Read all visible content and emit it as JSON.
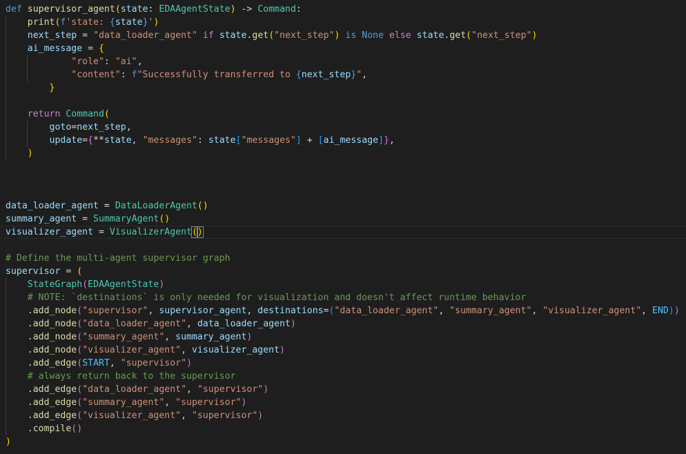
{
  "editor": {
    "lines": [
      [
        [
          "def",
          "kw"
        ],
        [
          " ",
          ""
        ],
        [
          "supervisor_agent",
          "fn"
        ],
        [
          "(",
          "b1"
        ],
        [
          "state",
          "var"
        ],
        [
          ": ",
          ""
        ],
        [
          "EDAAgentState",
          "cls"
        ],
        [
          ")",
          "b1"
        ],
        [
          " -> ",
          ""
        ],
        [
          "Command",
          "cls"
        ],
        [
          ":",
          ""
        ]
      ],
      [
        [
          "    ",
          ""
        ],
        [
          "print",
          "fn"
        ],
        [
          "(",
          "b1"
        ],
        [
          "f",
          "kw"
        ],
        [
          "'state: ",
          "str"
        ],
        [
          "{",
          "kw"
        ],
        [
          "state",
          "var"
        ],
        [
          "}",
          "kw"
        ],
        [
          "'",
          "str"
        ],
        [
          ")",
          "b1"
        ]
      ],
      [
        [
          "    ",
          ""
        ],
        [
          "next_step",
          "var"
        ],
        [
          " = ",
          ""
        ],
        [
          "\"data_loader_agent\"",
          "str"
        ],
        [
          " ",
          ""
        ],
        [
          "if",
          "ctl"
        ],
        [
          " ",
          ""
        ],
        [
          "state",
          "var"
        ],
        [
          ".",
          ""
        ],
        [
          "get",
          "fn"
        ],
        [
          "(",
          "b1"
        ],
        [
          "\"next_step\"",
          "str"
        ],
        [
          ")",
          "b1"
        ],
        [
          " ",
          ""
        ],
        [
          "is",
          "kw"
        ],
        [
          " ",
          ""
        ],
        [
          "None",
          "kw"
        ],
        [
          " ",
          ""
        ],
        [
          "else",
          "ctl"
        ],
        [
          " ",
          ""
        ],
        [
          "state",
          "var"
        ],
        [
          ".",
          ""
        ],
        [
          "get",
          "fn"
        ],
        [
          "(",
          "b1"
        ],
        [
          "\"next_step\"",
          "str"
        ],
        [
          ")",
          "b1"
        ]
      ],
      [
        [
          "    ",
          ""
        ],
        [
          "ai_message",
          "var"
        ],
        [
          " = ",
          ""
        ],
        [
          "{",
          "b1"
        ]
      ],
      [
        [
          "            ",
          ""
        ],
        [
          "\"role\"",
          "str"
        ],
        [
          ": ",
          ""
        ],
        [
          "\"ai\"",
          "str"
        ],
        [
          ",",
          ""
        ]
      ],
      [
        [
          "            ",
          ""
        ],
        [
          "\"content\"",
          "str"
        ],
        [
          ": ",
          ""
        ],
        [
          "f",
          "kw"
        ],
        [
          "\"Successfully transferred to ",
          "str"
        ],
        [
          "{",
          "kw"
        ],
        [
          "next_step",
          "var"
        ],
        [
          "}",
          "kw"
        ],
        [
          "\"",
          "str"
        ],
        [
          ",",
          ""
        ]
      ],
      [
        [
          "        ",
          ""
        ],
        [
          "}",
          "b1"
        ]
      ],
      [],
      [
        [
          "    ",
          ""
        ],
        [
          "return",
          "ctl"
        ],
        [
          " ",
          ""
        ],
        [
          "Command",
          "cls"
        ],
        [
          "(",
          "b1"
        ]
      ],
      [
        [
          "        ",
          ""
        ],
        [
          "goto",
          "var"
        ],
        [
          "=",
          ""
        ],
        [
          "next_step",
          "var"
        ],
        [
          ",",
          ""
        ]
      ],
      [
        [
          "        ",
          ""
        ],
        [
          "update",
          "var"
        ],
        [
          "=",
          ""
        ],
        [
          "{",
          "b2"
        ],
        [
          "**",
          ""
        ],
        [
          "state",
          "var"
        ],
        [
          ", ",
          ""
        ],
        [
          "\"messages\"",
          "str"
        ],
        [
          ": ",
          ""
        ],
        [
          "state",
          "var"
        ],
        [
          "[",
          "b3"
        ],
        [
          "\"messages\"",
          "str"
        ],
        [
          "]",
          "b3"
        ],
        [
          " + ",
          ""
        ],
        [
          "[",
          "b3"
        ],
        [
          "ai_message",
          "var"
        ],
        [
          "]",
          "b3"
        ],
        [
          "}",
          "b2"
        ],
        [
          ",",
          ""
        ]
      ],
      [
        [
          "    ",
          ""
        ],
        [
          ")",
          "b1"
        ]
      ],
      [],
      [],
      [],
      [
        [
          "data_loader_agent",
          "var"
        ],
        [
          " = ",
          ""
        ],
        [
          "DataLoaderAgent",
          "cls"
        ],
        [
          "()",
          "b1"
        ]
      ],
      [
        [
          "summary_agent",
          "var"
        ],
        [
          " = ",
          ""
        ],
        [
          "SummaryAgent",
          "cls"
        ],
        [
          "()",
          "b1"
        ]
      ],
      [
        [
          "visualizer_agent",
          "var"
        ],
        [
          " = ",
          ""
        ],
        [
          "VisualizerAgent",
          "cls"
        ],
        [
          "(",
          "b1 bmatch"
        ],
        [
          ")",
          "b1 bmatch"
        ]
      ],
      [],
      [
        [
          "# Define the multi-agent supervisor graph",
          "cmt"
        ]
      ],
      [
        [
          "supervisor",
          "var"
        ],
        [
          " = ",
          ""
        ],
        [
          "(",
          "b1"
        ]
      ],
      [
        [
          "    ",
          ""
        ],
        [
          "StateGraph",
          "cls"
        ],
        [
          "(",
          "b2"
        ],
        [
          "EDAAgentState",
          "cls"
        ],
        [
          ")",
          "b2"
        ]
      ],
      [
        [
          "    ",
          ""
        ],
        [
          "# NOTE: `destinations` is only needed for visualization and doesn't affect runtime behavior",
          "cmt"
        ]
      ],
      [
        [
          "    .",
          ""
        ],
        [
          "add_node",
          "fn"
        ],
        [
          "(",
          "b2"
        ],
        [
          "\"supervisor\"",
          "str"
        ],
        [
          ", ",
          ""
        ],
        [
          "supervisor_agent",
          "var"
        ],
        [
          ", ",
          ""
        ],
        [
          "destinations",
          "var"
        ],
        [
          "=",
          ""
        ],
        [
          "(",
          "b3"
        ],
        [
          "\"data_loader_agent\"",
          "str"
        ],
        [
          ", ",
          ""
        ],
        [
          "\"summary_agent\"",
          "str"
        ],
        [
          ", ",
          ""
        ],
        [
          "\"visualizer_agent\"",
          "str"
        ],
        [
          ", ",
          ""
        ],
        [
          "END",
          "const"
        ],
        [
          ")",
          "b3"
        ],
        [
          ")",
          "b2"
        ]
      ],
      [
        [
          "    .",
          ""
        ],
        [
          "add_node",
          "fn"
        ],
        [
          "(",
          "b2"
        ],
        [
          "\"data_loader_agent\"",
          "str"
        ],
        [
          ", ",
          ""
        ],
        [
          "data_loader_agent",
          "var"
        ],
        [
          ")",
          "b2"
        ]
      ],
      [
        [
          "    .",
          ""
        ],
        [
          "add_node",
          "fn"
        ],
        [
          "(",
          "b2"
        ],
        [
          "\"summary_agent\"",
          "str"
        ],
        [
          ", ",
          ""
        ],
        [
          "summary_agent",
          "var"
        ],
        [
          ")",
          "b2"
        ]
      ],
      [
        [
          "    .",
          ""
        ],
        [
          "add_node",
          "fn"
        ],
        [
          "(",
          "b2"
        ],
        [
          "\"visualizer_agent\"",
          "str"
        ],
        [
          ", ",
          ""
        ],
        [
          "visualizer_agent",
          "var"
        ],
        [
          ")",
          "b2"
        ]
      ],
      [
        [
          "    .",
          ""
        ],
        [
          "add_edge",
          "fn"
        ],
        [
          "(",
          "b2"
        ],
        [
          "START",
          "const"
        ],
        [
          ", ",
          ""
        ],
        [
          "\"supervisor\"",
          "str"
        ],
        [
          ")",
          "b2"
        ]
      ],
      [
        [
          "    ",
          ""
        ],
        [
          "# always return back to the supervisor",
          "cmt"
        ]
      ],
      [
        [
          "    .",
          ""
        ],
        [
          "add_edge",
          "fn"
        ],
        [
          "(",
          "b2"
        ],
        [
          "\"data_loader_agent\"",
          "str"
        ],
        [
          ", ",
          ""
        ],
        [
          "\"supervisor\"",
          "str"
        ],
        [
          ")",
          "b2"
        ]
      ],
      [
        [
          "    .",
          ""
        ],
        [
          "add_edge",
          "fn"
        ],
        [
          "(",
          "b2"
        ],
        [
          "\"summary_agent\"",
          "str"
        ],
        [
          ", ",
          ""
        ],
        [
          "\"supervisor\"",
          "str"
        ],
        [
          ")",
          "b2"
        ]
      ],
      [
        [
          "    .",
          ""
        ],
        [
          "add_edge",
          "fn"
        ],
        [
          "(",
          "b2"
        ],
        [
          "\"visualizer_agent\"",
          "str"
        ],
        [
          ", ",
          ""
        ],
        [
          "\"supervisor\"",
          "str"
        ],
        [
          ")",
          "b2"
        ]
      ],
      [
        [
          "    .",
          ""
        ],
        [
          "compile",
          "fn"
        ],
        [
          "()",
          "b2"
        ]
      ],
      [
        [
          ")",
          "b1"
        ]
      ]
    ]
  }
}
